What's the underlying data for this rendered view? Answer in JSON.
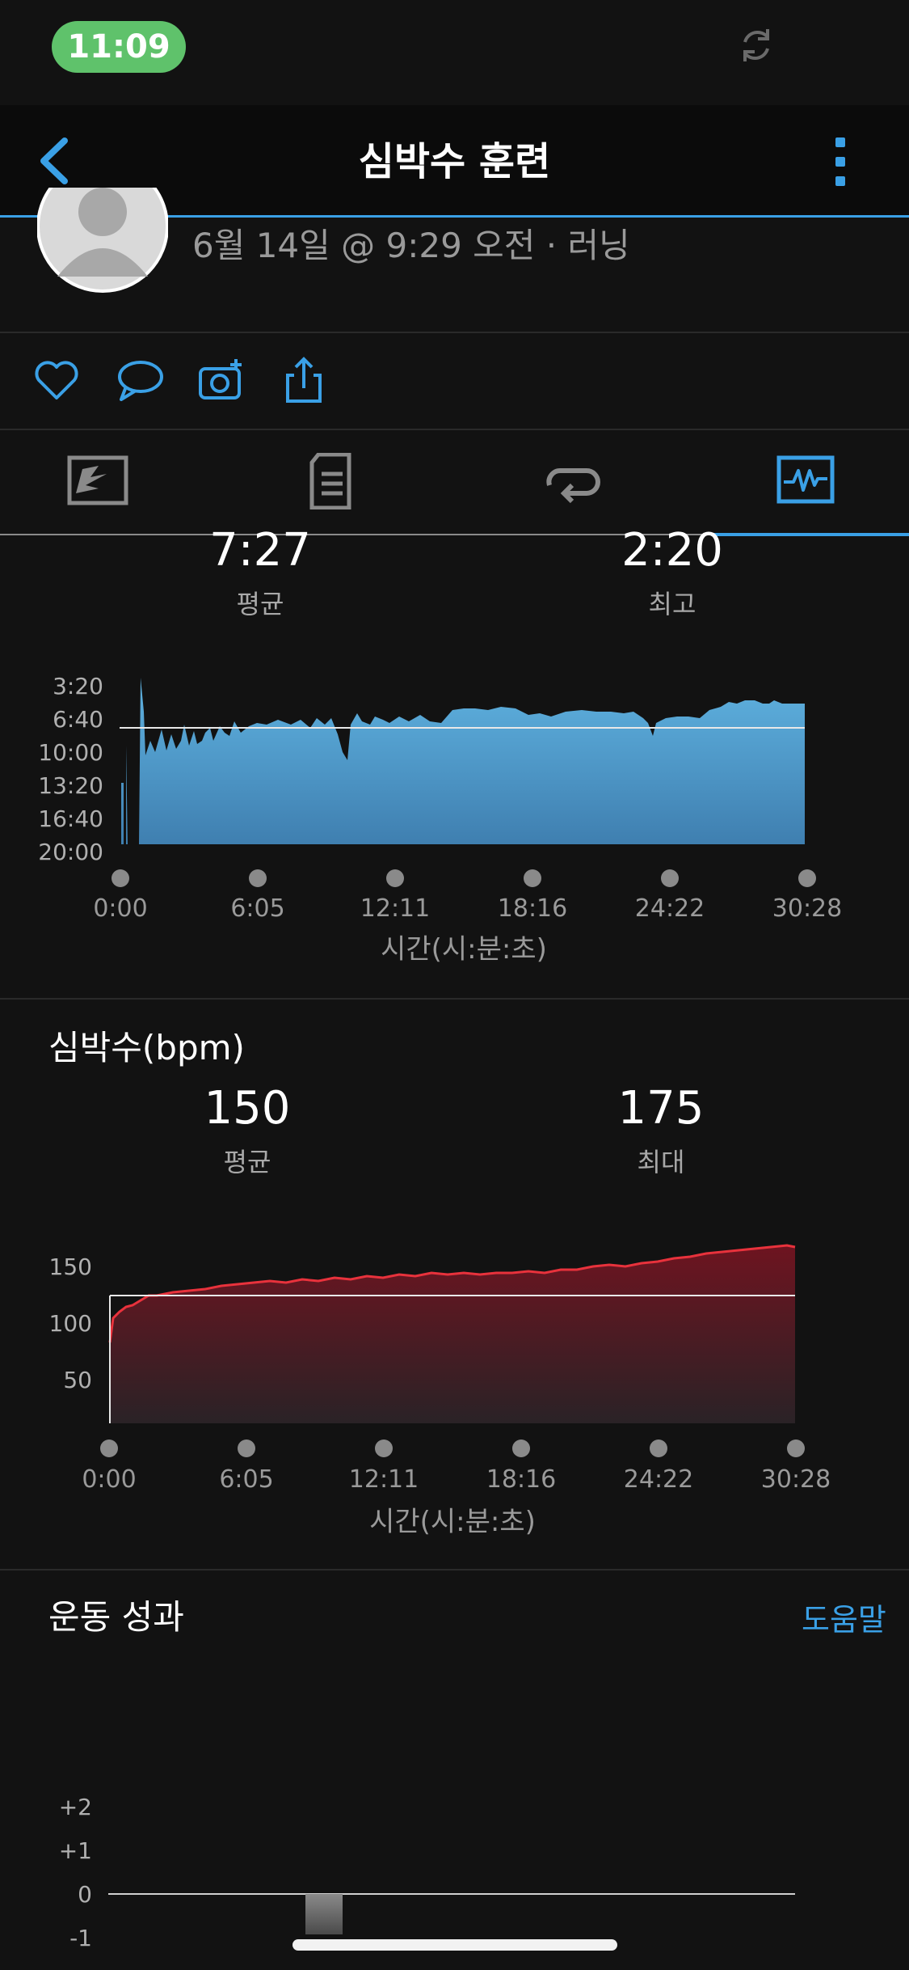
{
  "status_bar": {
    "time": "11:09"
  },
  "header": {
    "title": "심박수 훈련"
  },
  "activity": {
    "subtitle": "6월 14일 @ 9:29 오전 · 러닝"
  },
  "pace": {
    "avg_value": "7:27",
    "avg_label": "평균",
    "best_value": "2:20",
    "best_label": "최고",
    "y_ticks": [
      "3:20",
      "6:40",
      "10:00",
      "13:20",
      "16:40",
      "20:00"
    ],
    "x_ticks": [
      "0:00",
      "6:05",
      "12:11",
      "18:16",
      "24:22",
      "30:28"
    ],
    "x_axis_title": "시간(시:분:초)"
  },
  "heart_rate": {
    "title": "심박수(bpm)",
    "avg_value": "150",
    "avg_label": "평균",
    "max_value": "175",
    "max_label": "최대",
    "y_ticks": [
      "150",
      "100",
      "50"
    ],
    "x_ticks": [
      "0:00",
      "6:05",
      "12:11",
      "18:16",
      "24:22",
      "30:28"
    ],
    "x_axis_title": "시간(시:분:초)"
  },
  "performance": {
    "title": "운동 성과",
    "help_label": "도움말",
    "y_ticks": [
      "+2",
      "+1",
      "0",
      "-1"
    ]
  },
  "colors": {
    "accent": "#3aa0e6",
    "pace_fill": "#5aa8d8",
    "hr_line": "#e8323c"
  }
}
